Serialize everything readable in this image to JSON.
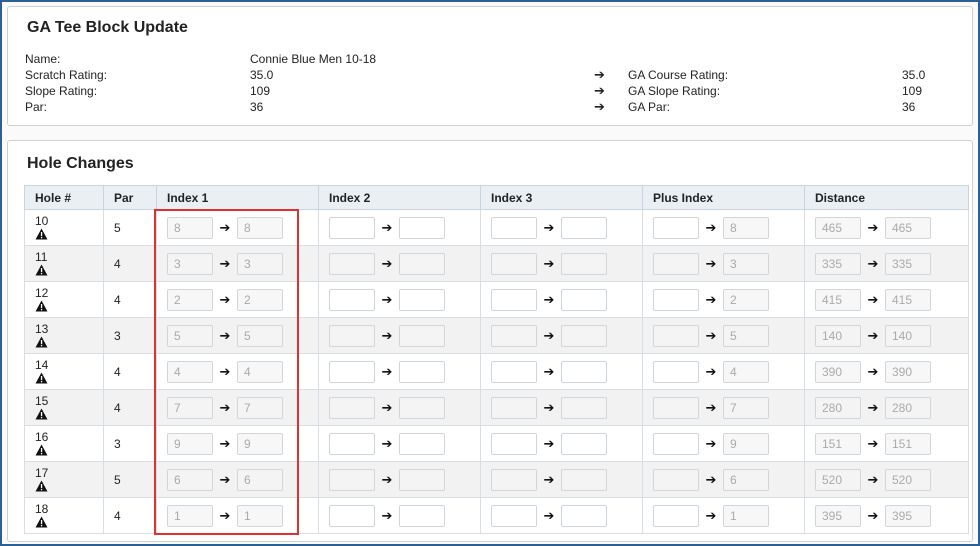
{
  "header": {
    "title": "GA Tee Block Update"
  },
  "info": {
    "rows": [
      {
        "label": "Name:",
        "value": "Connie Blue Men 10-18"
      },
      {
        "label": "Scratch Rating:",
        "value": "35.0",
        "arrow": "➔",
        "ga_label": "GA Course Rating:",
        "ga_value": "35.0"
      },
      {
        "label": "Slope Rating:",
        "value": "109",
        "arrow": "➔",
        "ga_label": "GA Slope Rating:",
        "ga_value": "109"
      },
      {
        "label": "Par:",
        "value": "36",
        "arrow": "➔",
        "ga_label": "GA Par:",
        "ga_value": "36"
      }
    ]
  },
  "holes_section": {
    "title": "Hole Changes",
    "columns": [
      "Hole #",
      "Par",
      "Index 1",
      "Index 2",
      "Index 3",
      "Plus Index",
      "Distance"
    ],
    "arrow": "➔",
    "rows": [
      {
        "hole": "10",
        "par": "5",
        "index1_from": "8",
        "index1_to": "8",
        "plus_to": "8",
        "dist_from": "465",
        "dist_to": "465"
      },
      {
        "hole": "11",
        "par": "4",
        "index1_from": "3",
        "index1_to": "3",
        "plus_to": "3",
        "dist_from": "335",
        "dist_to": "335"
      },
      {
        "hole": "12",
        "par": "4",
        "index1_from": "2",
        "index1_to": "2",
        "plus_to": "2",
        "dist_from": "415",
        "dist_to": "415"
      },
      {
        "hole": "13",
        "par": "3",
        "index1_from": "5",
        "index1_to": "5",
        "plus_to": "5",
        "dist_from": "140",
        "dist_to": "140"
      },
      {
        "hole": "14",
        "par": "4",
        "index1_from": "4",
        "index1_to": "4",
        "plus_to": "4",
        "dist_from": "390",
        "dist_to": "390"
      },
      {
        "hole": "15",
        "par": "4",
        "index1_from": "7",
        "index1_to": "7",
        "plus_to": "7",
        "dist_from": "280",
        "dist_to": "280"
      },
      {
        "hole": "16",
        "par": "3",
        "index1_from": "9",
        "index1_to": "9",
        "plus_to": "9",
        "dist_from": "151",
        "dist_to": "151"
      },
      {
        "hole": "17",
        "par": "5",
        "index1_from": "6",
        "index1_to": "6",
        "plus_to": "6",
        "dist_from": "520",
        "dist_to": "520"
      },
      {
        "hole": "18",
        "par": "4",
        "index1_from": "1",
        "index1_to": "1",
        "plus_to": "1",
        "dist_from": "395",
        "dist_to": "395"
      }
    ]
  },
  "icons": {
    "row_status": "warning-icon"
  },
  "colors": {
    "highlight": "#e03131",
    "frame": "#2c5f93",
    "header_bg": "#eaeff4"
  }
}
